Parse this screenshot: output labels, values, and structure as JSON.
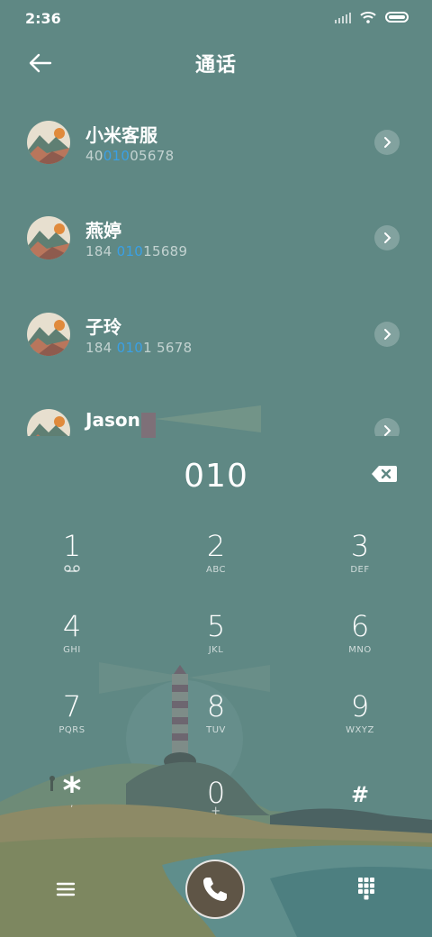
{
  "status_bar": {
    "time": "2:36"
  },
  "header": {
    "title": "通话"
  },
  "contacts": [
    {
      "name": "小米客服",
      "number_pre": "40",
      "number_match": "010",
      "number_post": "05678"
    },
    {
      "name": "燕婷",
      "number_pre": "184 ",
      "number_match": "010",
      "number_post": "15689"
    },
    {
      "name": "子玲",
      "number_pre": "184 ",
      "number_match": "010",
      "number_post": "1 5678"
    },
    {
      "name": "Jason",
      "number_pre": "",
      "number_match": "",
      "number_post": ""
    }
  ],
  "dial": {
    "input": "010"
  },
  "keypad": [
    {
      "digit": "1",
      "letters": ""
    },
    {
      "digit": "2",
      "letters": "ABC"
    },
    {
      "digit": "3",
      "letters": "DEF"
    },
    {
      "digit": "4",
      "letters": "GHI"
    },
    {
      "digit": "5",
      "letters": "JKL"
    },
    {
      "digit": "6",
      "letters": "MNO"
    },
    {
      "digit": "7",
      "letters": "PQRS"
    },
    {
      "digit": "8",
      "letters": "TUV"
    },
    {
      "digit": "9",
      "letters": "WXYZ"
    },
    {
      "digit": "*",
      "letters": ","
    },
    {
      "digit": "0",
      "letters": "+"
    },
    {
      "digit": "#",
      "letters": ""
    }
  ],
  "colors": {
    "background": "#5f8884",
    "highlight": "#3aa0e6",
    "call_button": "#5f5546"
  },
  "icons": {
    "back": "arrow-left-icon",
    "chevron": "chevron-right-icon",
    "backspace": "backspace-icon",
    "voicemail": "voicemail-icon",
    "menu": "menu-icon",
    "call": "phone-icon",
    "dialpad": "dialpad-icon"
  }
}
